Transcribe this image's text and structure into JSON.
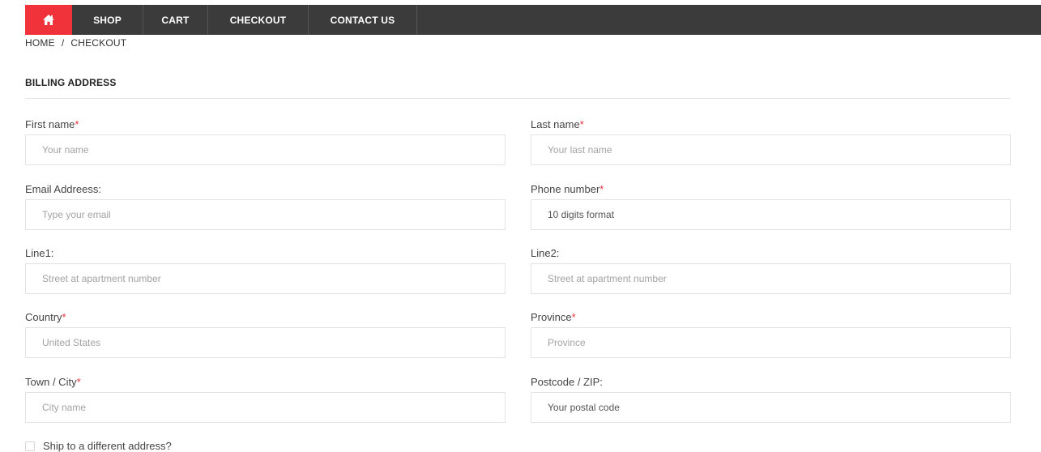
{
  "nav": {
    "home_icon": "home-icon",
    "items": [
      "SHOP",
      "CART",
      "CHECKOUT",
      "CONTACT US"
    ],
    "accent_color": "#f0333b",
    "bar_color": "#3b3b3b"
  },
  "breadcrumb": {
    "home": "HOME",
    "separator": "/",
    "current": "CHECKOUT"
  },
  "section": {
    "title": "BILLING ADDRESS"
  },
  "form": {
    "first_name": {
      "label": "First name",
      "required": "*",
      "placeholder": "Your name"
    },
    "last_name": {
      "label": "Last name",
      "required": "*",
      "placeholder": "Your last name"
    },
    "email": {
      "label": "Email Addreess:",
      "placeholder": "Type your email"
    },
    "phone": {
      "label": "Phone number",
      "required": "*",
      "value": "10 digits format"
    },
    "line1": {
      "label": "Line1:",
      "placeholder": "Street at apartment number"
    },
    "line2": {
      "label": "Line2:",
      "placeholder": "Street at apartment number"
    },
    "country": {
      "label": "Country",
      "required": "*",
      "placeholder": "United States"
    },
    "province": {
      "label": "Province",
      "required": "*",
      "placeholder": "Province"
    },
    "city": {
      "label": "Town / City",
      "required": "*",
      "placeholder": "City name"
    },
    "postcode": {
      "label": "Postcode / ZIP:",
      "value": "Your postal code"
    }
  },
  "ship_different": {
    "label": "Ship to a different address?"
  }
}
